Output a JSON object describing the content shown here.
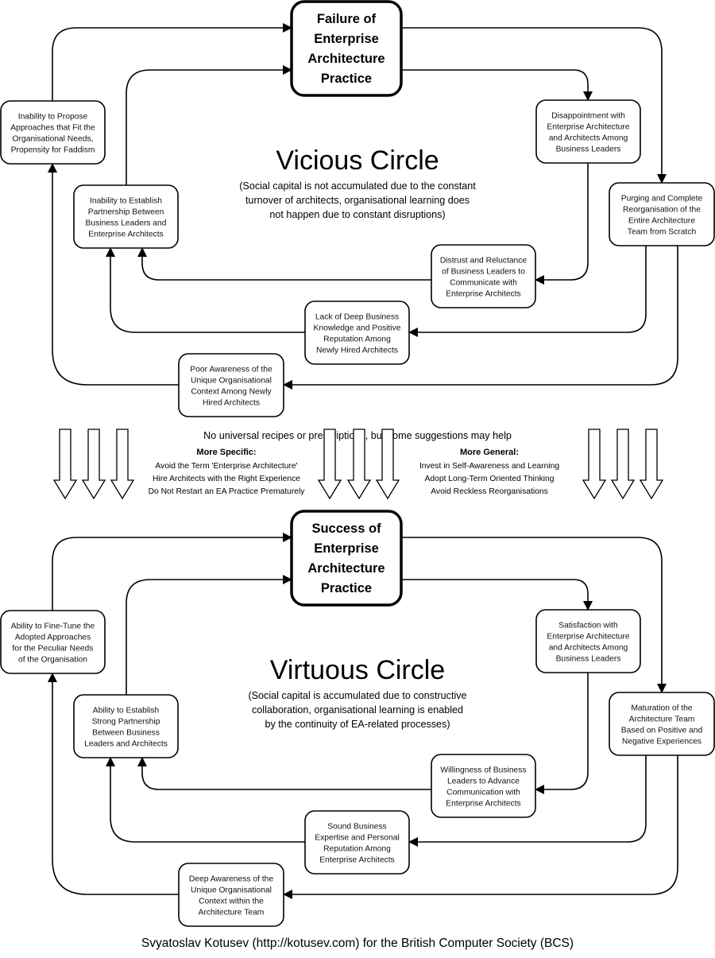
{
  "vicious": {
    "center": [
      "Failure of",
      "Enterprise",
      "Architecture",
      "Practice"
    ],
    "title": "Vicious Circle",
    "subtitle": [
      "(Social capital is not accumulated due to the constant",
      "turnover of architects, organisational learning does",
      "not happen due to constant disruptions)"
    ],
    "nodes": {
      "left1": [
        "Inability to Propose",
        "Approaches that Fit the",
        "Organisational Needs,",
        "Propensity for Faddism"
      ],
      "left2": [
        "Inability to Establish",
        "Partnership Between",
        "Business Leaders and",
        "Enterprise Architects"
      ],
      "right1": [
        "Disappointment with",
        "Enterprise Architecture",
        "and Architects Among",
        "Business Leaders"
      ],
      "right2": [
        "Purging and Complete",
        "Reorganisation of the",
        "Entire Architecture",
        "Team from Scratch"
      ],
      "mid1": [
        "Distrust and Reluctance",
        "of Business Leaders to",
        "Communicate with",
        "Enterprise Architects"
      ],
      "mid2": [
        "Lack of Deep Business",
        "Knowledge and Positive",
        "Reputation Among",
        "Newly Hired Architects"
      ],
      "mid3": [
        "Poor Awareness of the",
        "Unique Organisational",
        "Context Among Newly",
        "Hired Architects"
      ]
    }
  },
  "suggestions": {
    "heading": "No universal recipes or prescriptions, but some suggestions may help",
    "specific_title": "More Specific:",
    "specific": [
      "Avoid the Term 'Enterprise Architecture'",
      "Hire Architects with the Right Experience",
      "Do Not Restart an EA Practice Prematurely"
    ],
    "general_title": "More General:",
    "general": [
      "Invest in Self-Awareness and Learning",
      "Adopt Long-Term Oriented Thinking",
      "Avoid Reckless Reorganisations"
    ]
  },
  "virtuous": {
    "center": [
      "Success of",
      "Enterprise",
      "Architecture",
      "Practice"
    ],
    "title": "Virtuous Circle",
    "subtitle": [
      "(Social capital is accumulated due to constructive",
      "collaboration, organisational learning is enabled",
      "by the continuity of EA-related processes)"
    ],
    "nodes": {
      "left1": [
        "Ability to Fine-Tune the",
        "Adopted Approaches",
        "for the Peculiar Needs",
        "of the Organisation"
      ],
      "left2": [
        "Ability to Establish",
        "Strong Partnership",
        "Between Business",
        "Leaders and Architects"
      ],
      "right1": [
        "Satisfaction with",
        "Enterprise Architecture",
        "and Architects Among",
        "Business Leaders"
      ],
      "right2": [
        "Maturation of the",
        "Architecture Team",
        "Based on Positive and",
        "Negative Experiences"
      ],
      "mid1": [
        "Willingness of Business",
        "Leaders to Advance",
        "Communication with",
        "Enterprise Architects"
      ],
      "mid2": [
        "Sound Business",
        "Expertise and Personal",
        "Reputation Among",
        "Enterprise Architects"
      ],
      "mid3": [
        "Deep Awareness of the",
        "Unique Organisational",
        "Context within the",
        "Architecture Team"
      ]
    }
  },
  "footer": "Svyatoslav Kotusev (http://kotusev.com) for the British Computer Society (BCS)"
}
